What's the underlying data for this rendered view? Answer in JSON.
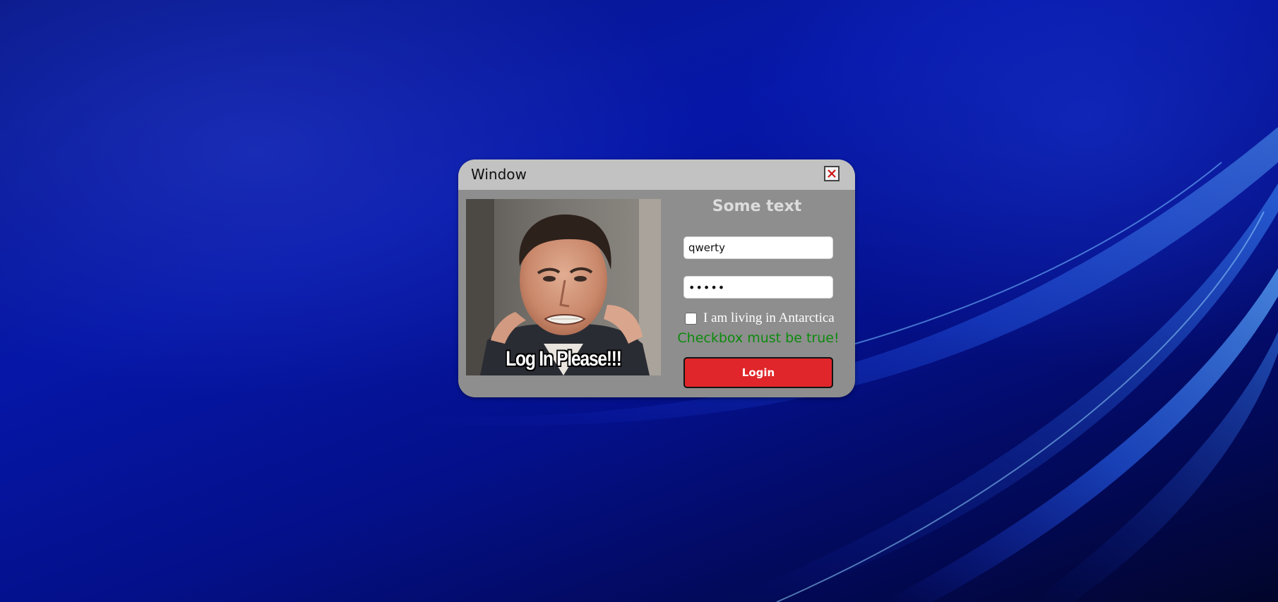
{
  "window": {
    "title": "Window",
    "close_icon": "close-x-icon"
  },
  "image": {
    "caption": "Log In Please!!!"
  },
  "form": {
    "heading": "Some text",
    "username_value": "qwerty",
    "password_value": "•••••",
    "checkbox_label": "I am living in Antarctica",
    "checkbox_checked": false,
    "validation_message": "Checkbox must be true!",
    "login_label": "Login"
  },
  "colors": {
    "window_body": "#8e8e8e",
    "titlebar": "#c2c2c2",
    "login_button": "#e0262a",
    "validation_text": "#0d8a0d",
    "close_icon": "#cc1111",
    "desktop_background": "#0617a8"
  }
}
